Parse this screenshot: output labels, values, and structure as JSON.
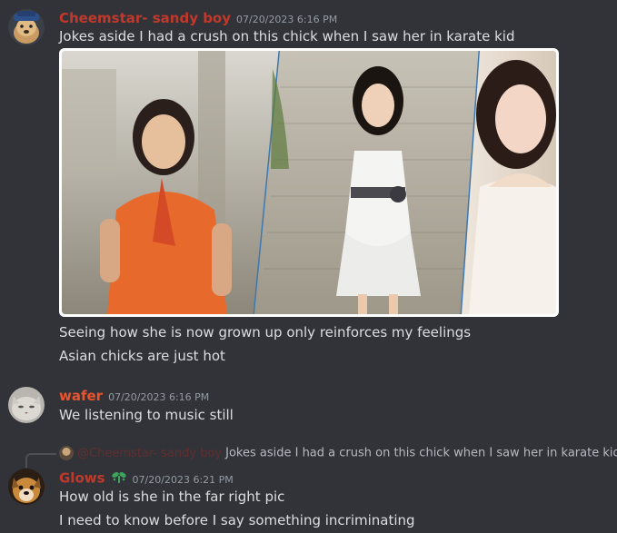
{
  "messages": [
    {
      "username": "Cheemstar- sandy boy",
      "username_color": "#c0392b",
      "timestamp": "07/20/2023 6:16 PM",
      "lines": [
        "Jokes aside I had a crush on this chick when I saw her in karate kid",
        "Seeing how she is now grown up only reinforces my feelings",
        "Asian chicks are just hot"
      ],
      "attachment": "image-collage"
    },
    {
      "username": "wafer",
      "username_color": "#e8542e",
      "timestamp": "07/20/2023 6:16 PM",
      "lines": [
        "We listening to music still"
      ]
    },
    {
      "reply_to": {
        "username": "@Cheemstar- sandy boy",
        "text": "Jokes aside I had a crush on this chick when I saw her in karate kid",
        "icon": "image-icon"
      },
      "username": "Glows",
      "username_color": "#c0392b",
      "badge_icon": "sprout-icon",
      "timestamp": "07/20/2023 6:21 PM",
      "lines": [
        "How old is she in the far right pic",
        "I need to know before I say something incriminating"
      ]
    }
  ],
  "colors": {
    "background": "#313338",
    "text": "#dbdee1",
    "muted": "#949ba4"
  }
}
